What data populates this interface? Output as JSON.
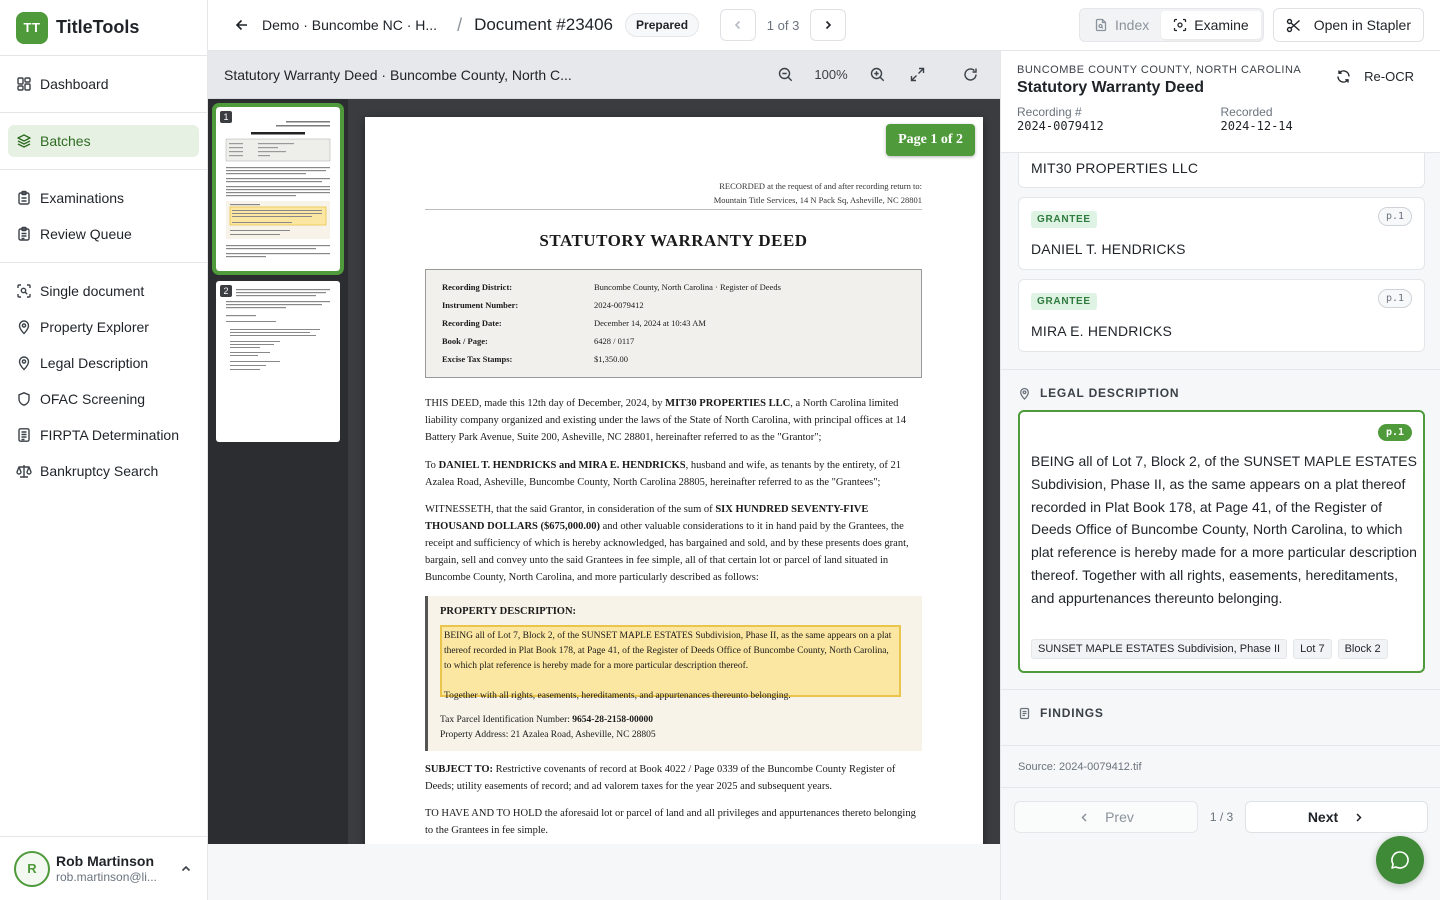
{
  "brand": {
    "logo": "TT",
    "name": "TitleTools"
  },
  "nav": {
    "group1": [
      {
        "label": "Dashboard",
        "icon": "dashboard-icon"
      }
    ],
    "group2": [
      {
        "label": "Batches",
        "icon": "layers-icon",
        "active": true
      }
    ],
    "group3": [
      {
        "label": "Examinations",
        "icon": "clipboard-icon"
      },
      {
        "label": "Review Queue",
        "icon": "clipboard-list-icon"
      }
    ],
    "group4": [
      {
        "label": "Single document",
        "icon": "scan-icon"
      },
      {
        "label": "Property Explorer",
        "icon": "map-pin-icon"
      },
      {
        "label": "Legal Description",
        "icon": "map-pin-icon"
      },
      {
        "label": "OFAC Screening",
        "icon": "shield-icon"
      },
      {
        "label": "FIRPTA Determination",
        "icon": "document-icon"
      },
      {
        "label": "Bankruptcy Search",
        "icon": "scale-icon"
      }
    ]
  },
  "user": {
    "initial": "R",
    "name": "Rob Martinson",
    "email": "rob.martinson@li..."
  },
  "topbar": {
    "crumb": "Demo · Buncombe NC · H...",
    "separator": "/",
    "doc_title": "Document #23406",
    "status": "Prepared",
    "pager": "1 of 3",
    "tab_index": "Index",
    "tab_examine": "Examine",
    "open_stapler": "Open in Stapler"
  },
  "viewer": {
    "title": "Statutory Warranty Deed · Buncombe County, North C...",
    "zoom": "100%",
    "page_badge": "Page 1 of 2",
    "thumbnails": [
      "1",
      "2"
    ]
  },
  "document": {
    "recorded_line1": "RECORDED at the request of and after recording return to:",
    "recorded_line2": "Mountain Title Services, 14 N Pack Sq, Asheville, NC 28801",
    "heading": "STATUTORY WARRANTY DEED",
    "info": [
      {
        "k": "Recording District:",
        "v": "Buncombe County, North Carolina · Register of Deeds"
      },
      {
        "k": "Instrument Number:",
        "v": "2024-0079412"
      },
      {
        "k": "Recording Date:",
        "v": "December 14, 2024 at 10:43 AM"
      },
      {
        "k": "Book / Page:",
        "v": "6428 / 0117"
      },
      {
        "k": "Excise Tax Stamps:",
        "v": "$1,350.00"
      }
    ],
    "p1_a": "THIS DEED, made this 12th day of December, 2024, by ",
    "p1_b": "MIT30 PROPERTIES LLC",
    "p1_c": ", a North Carolina limited liability company organized and existing under the laws of the State of North Carolina, with principal offices at 14 Battery Park Avenue, Suite 200, Asheville, NC 28801, hereinafter referred to as the \"Grantor\";",
    "p2_a": "To ",
    "p2_b": "DANIEL T. HENDRICKS and MIRA E. HENDRICKS",
    "p2_c": ", husband and wife, as tenants by the entirety, of 21 Azalea Road, Asheville, Buncombe County, North Carolina 28805, hereinafter referred to as the \"Grantees\";",
    "p3_a": "WITNESSETH, that the said Grantor, in consideration of the sum of ",
    "p3_b": "SIX HUNDRED SEVENTY-FIVE THOUSAND DOLLARS ($675,000.00)",
    "p3_c": " and other valuable considerations to it in hand paid by the Grantees, the receipt and sufficiency of which is hereby acknowledged, has bargained and sold, and by these presents does grant, bargain, sell and convey unto the said Grantees in fee simple, all of that certain lot or parcel of land situated in Buncombe County, North Carolina, and more particularly described as follows:",
    "prop_heading": "PROPERTY DESCRIPTION:",
    "prop_text1": "BEING all of Lot 7, Block 2, of the SUNSET MAPLE ESTATES Subdivision, Phase II, as the same appears on a plat thereof recorded in Plat Book 178, at Page 41, of the Register of Deeds Office of Buncombe County, North Carolina, to which plat reference is hereby made for a more particular description thereof.",
    "prop_text2": "Together with all rights, easements, hereditaments, and appurtenances thereunto belonging.",
    "parcel_label": "Tax Parcel Identification Number: ",
    "parcel_value": "9654-28-2158-00000",
    "address": "Property Address: 21 Azalea Road, Asheville, NC 28805",
    "p4_a": "SUBJECT TO:",
    "p4_b": " Restrictive covenants of record at Book 4022 / Page 0339 of the Buncombe County Register of Deeds; utility easements of record; and ad valorem taxes for the year 2025 and subsequent years.",
    "p5": "TO HAVE AND TO HOLD the aforesaid lot or parcel of land and all privileges and appurtenances thereto belonging to the Grantees in fee simple."
  },
  "panel": {
    "county": "BUNCOMBE COUNTY COUNTY, NORTH CAROLINA",
    "title": "Statutory Warranty Deed",
    "reocr": "Re-OCR",
    "recording_label": "Recording #",
    "recording_value": "2024-0079412",
    "recorded_label": "Recorded",
    "recorded_value": "2024-12-14",
    "grantor_name": "MIT30 PROPERTIES LLC",
    "grantees": [
      {
        "role": "GRANTEE",
        "name": "DANIEL T. HENDRICKS",
        "page": "p.1"
      },
      {
        "role": "GRANTEE",
        "name": "MIRA E. HENDRICKS",
        "page": "p.1"
      }
    ],
    "legal_label": "LEGAL DESCRIPTION",
    "legal_page": "p.1",
    "legal_text": "BEING all of Lot 7, Block 2, of the SUNSET MAPLE ESTATES Subdivision, Phase II, as the same appears on a plat thereof recorded in Plat Book 178, at Page 41, of the Register of Deeds Office of Buncombe County, North Carolina, to which plat reference is hereby made for a more particular description thereof. Together with all rights, easements, hereditaments, and appurtenances thereunto belonging.",
    "chips": [
      "SUNSET MAPLE ESTATES Subdivision, Phase II",
      "Lot 7",
      "Block 2"
    ],
    "findings_label": "FINDINGS",
    "source": "Source: 2024-0079412.tif",
    "prev": "Prev",
    "count": "1 / 3",
    "next": "Next"
  },
  "colors": {
    "accent": "#4f9a3a",
    "highlight": "#fbe7a1"
  }
}
